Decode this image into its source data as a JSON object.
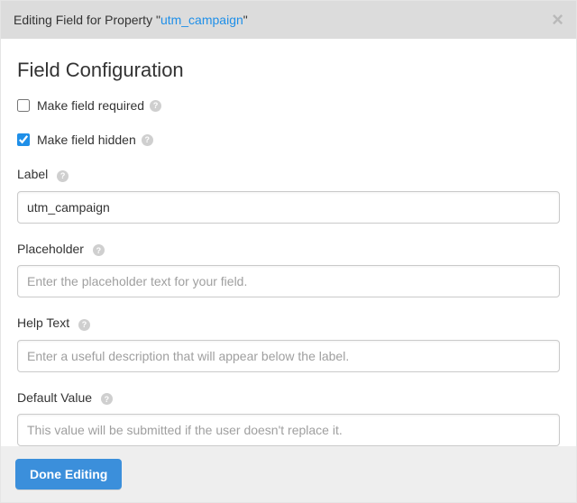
{
  "header": {
    "prefix": "Editing Field for Property \"",
    "property": "utm_campaign",
    "suffix": "\""
  },
  "section_title": "Field Configuration",
  "checkboxes": {
    "required": {
      "label": "Make field required",
      "checked": false
    },
    "hidden": {
      "label": "Make field hidden",
      "checked": true
    }
  },
  "fields": {
    "label": {
      "label": "Label",
      "value": "utm_campaign",
      "placeholder": ""
    },
    "placeholder": {
      "label": "Placeholder",
      "value": "",
      "placeholder": "Enter the placeholder text for your field."
    },
    "help_text": {
      "label": "Help Text",
      "value": "",
      "placeholder": "Enter a useful description that will appear below the label."
    },
    "default_value": {
      "label": "Default Value",
      "value": "",
      "placeholder": "This value will be submitted if the user doesn't replace it."
    }
  },
  "footer": {
    "done_label": "Done Editing"
  },
  "icons": {
    "help_glyph": "?"
  }
}
